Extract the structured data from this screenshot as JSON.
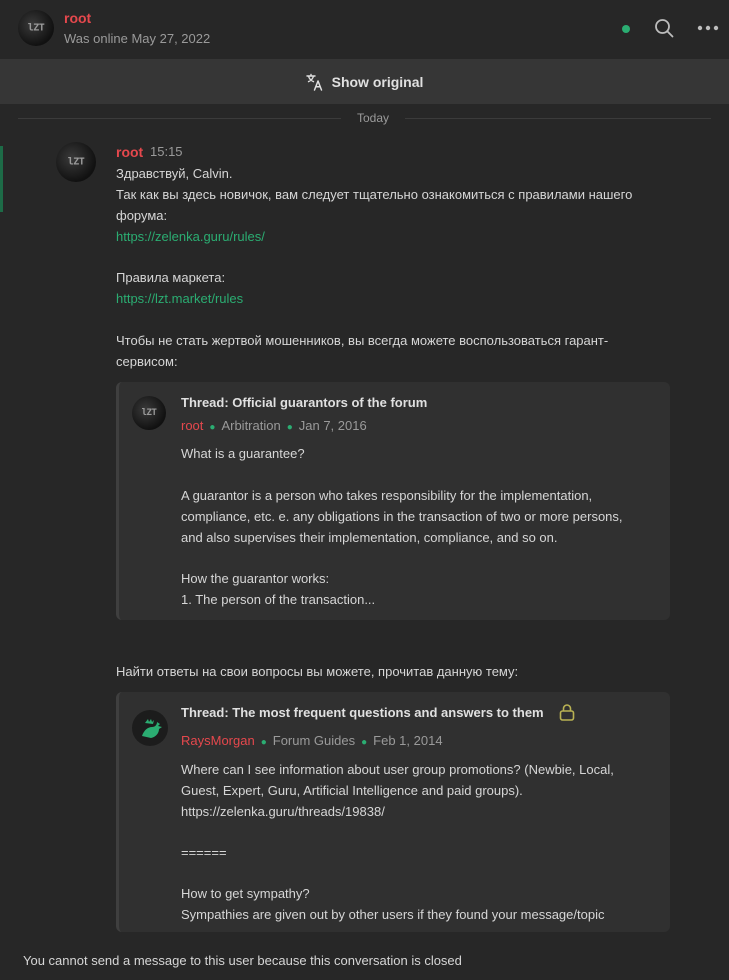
{
  "header": {
    "name": "root",
    "status": "Was online May 27, 2022",
    "avatar_text": "lZT"
  },
  "show_original": "Show original",
  "divider": "Today",
  "message": {
    "author": "root",
    "time": "15:15",
    "lines": [
      "Здравствуй, Calvin.",
      "Так как вы здесь новичок, вам следует тщательно ознакомиться с правилами нашего",
      "форума:"
    ],
    "link1": "https://zelenka.guru/rules/",
    "market_label": "Правила маркета:",
    "link2": "https://lzt.market/rules",
    "guarantor_line1": "Чтобы не стать жертвой мошенников, вы всегда можете воспользоваться гарант-",
    "guarantor_line2": "сервисом:",
    "faq_line": "Найти ответы на свои вопросы вы можете, прочитав данную тему:"
  },
  "quote1": {
    "title": "Thread: Official guarantors of the forum",
    "author": "root",
    "section": "Arbitration",
    "date": "Jan 7, 2016",
    "lines": [
      "What is a guarantee?",
      "",
      "A guarantor is a person who takes responsibility for the implementation,",
      "compliance, etc. e. any obligations in the transaction of two or more persons,",
      "and also supervises their implementation, compliance, and so on.",
      "",
      "How the guarantor works:",
      "1. The person of the transaction..."
    ]
  },
  "quote2": {
    "title": "Thread: The most frequent questions and answers to them",
    "author": "RaysMorgan",
    "section": "Forum Guides",
    "date": "Feb 1, 2014",
    "lines": [
      "Where can I see information about user group promotions? (Newbie, Local,",
      "Guest, Expert, Guru, Artificial Intelligence and paid groups).",
      "https://zelenka.guru/threads/19838/",
      "",
      "======",
      "",
      "How to get sympathy?",
      "Sympathies are given out by other users if they found your message/topic"
    ]
  },
  "footer": "You cannot send a message to this user because this conversation is closed",
  "colors": {
    "accent_green": "#2bad72",
    "username_red": "#e5484d",
    "background": "#272727"
  }
}
